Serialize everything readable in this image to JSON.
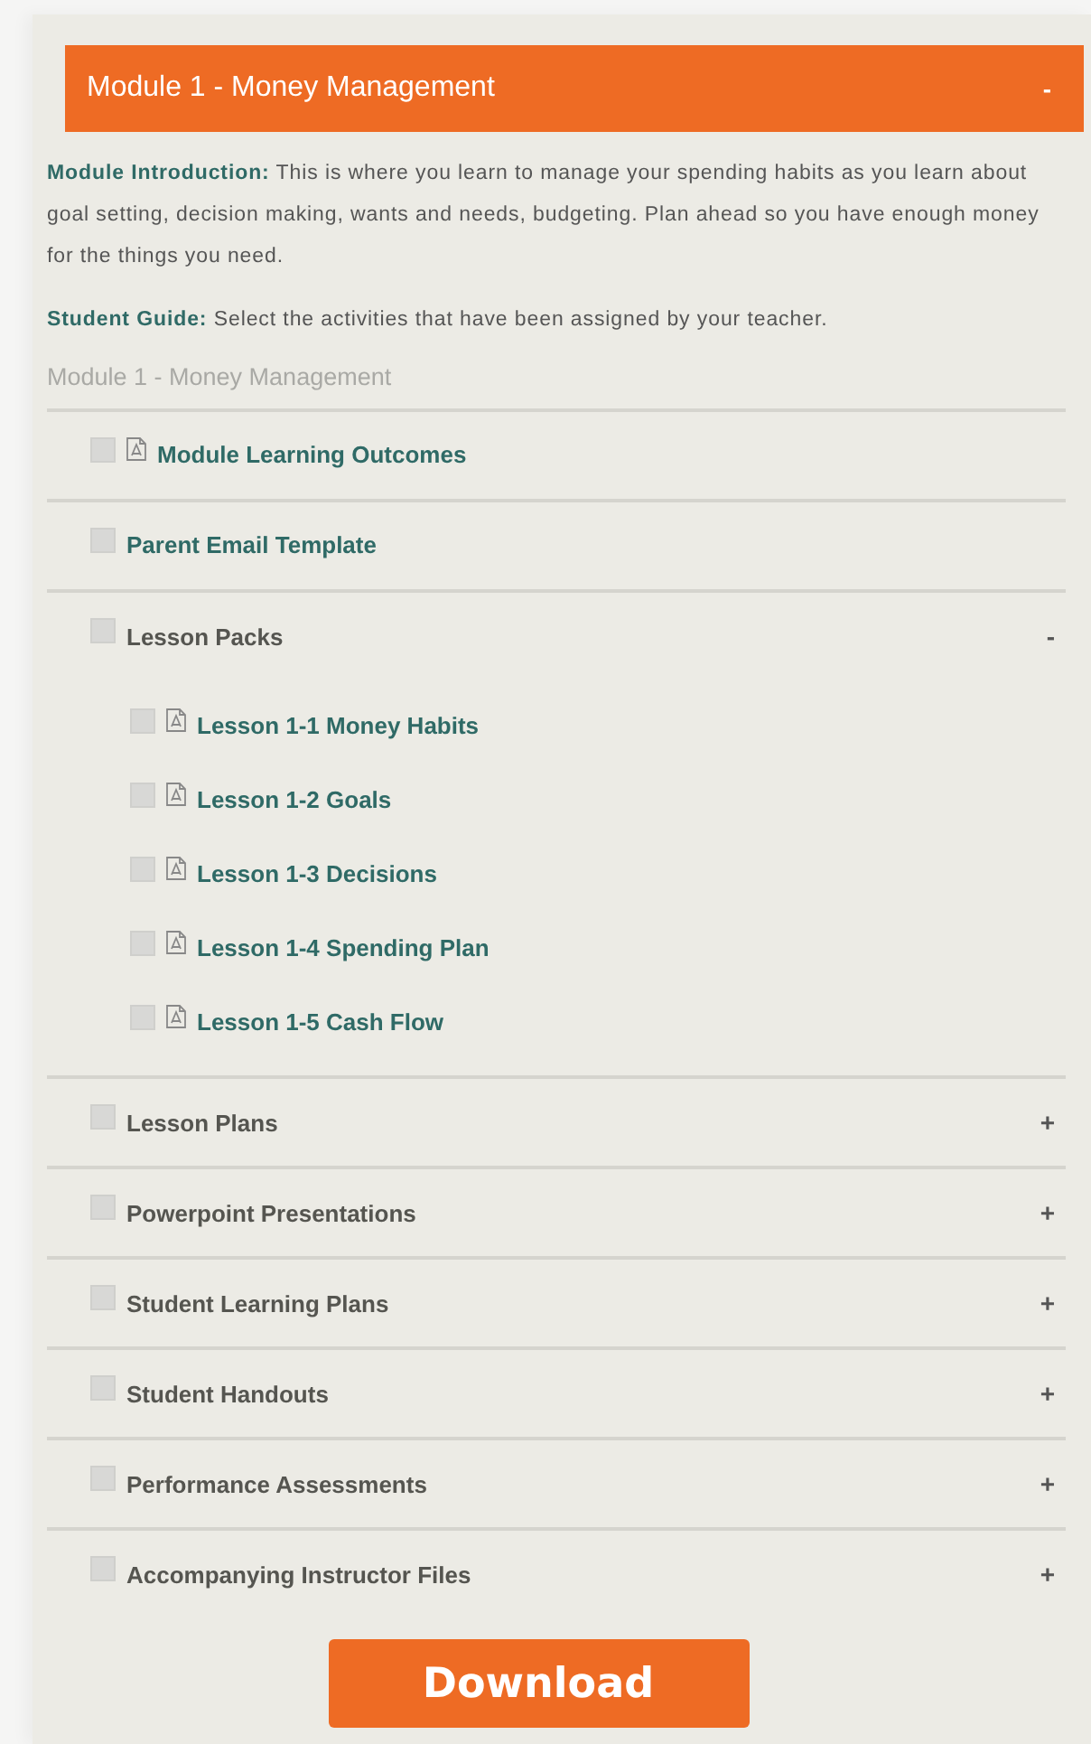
{
  "module": {
    "title": "Module 1 - Money Management",
    "toggle": "-"
  },
  "intro": [
    {
      "label": "Module Introduction:",
      "text": "This is where you learn to manage your spending habits as you learn about goal setting, decision making, wants and needs, budgeting. Plan ahead so you have enough money for the things you need."
    },
    {
      "label": "Student Guide:",
      "text": "Select the activities that have been assigned by your teacher."
    }
  ],
  "section_label": "Module 1 - Money Management",
  "items": [
    {
      "kind": "pdf",
      "label": "Module Learning Outcomes",
      "checked": false
    },
    {
      "kind": "link",
      "label": "Parent Email Template",
      "checked": false
    },
    {
      "kind": "group",
      "label": "Lesson Packs",
      "checked": false,
      "toggle": "-",
      "children": [
        {
          "kind": "pdf",
          "label": "Lesson 1-1 Money Habits",
          "checked": false
        },
        {
          "kind": "pdf",
          "label": "Lesson 1-2 Goals",
          "checked": false
        },
        {
          "kind": "pdf",
          "label": "Lesson 1-3 Decisions",
          "checked": false
        },
        {
          "kind": "pdf",
          "label": "Lesson 1-4 Spending Plan",
          "checked": false
        },
        {
          "kind": "pdf",
          "label": "Lesson 1-5 Cash Flow",
          "checked": false
        }
      ]
    },
    {
      "kind": "group",
      "label": "Lesson Plans",
      "checked": false,
      "toggle": "+"
    },
    {
      "kind": "group",
      "label": "Powerpoint Presentations",
      "checked": false,
      "toggle": "+"
    },
    {
      "kind": "group",
      "label": "Student Learning Plans",
      "checked": false,
      "toggle": "+"
    },
    {
      "kind": "group",
      "label": "Student Handouts",
      "checked": false,
      "toggle": "+"
    },
    {
      "kind": "group",
      "label": "Performance Assessments",
      "checked": false,
      "toggle": "+"
    },
    {
      "kind": "group",
      "label": "Accompanying Instructor Files",
      "checked": false,
      "toggle": "+"
    }
  ],
  "download_button": "Download"
}
